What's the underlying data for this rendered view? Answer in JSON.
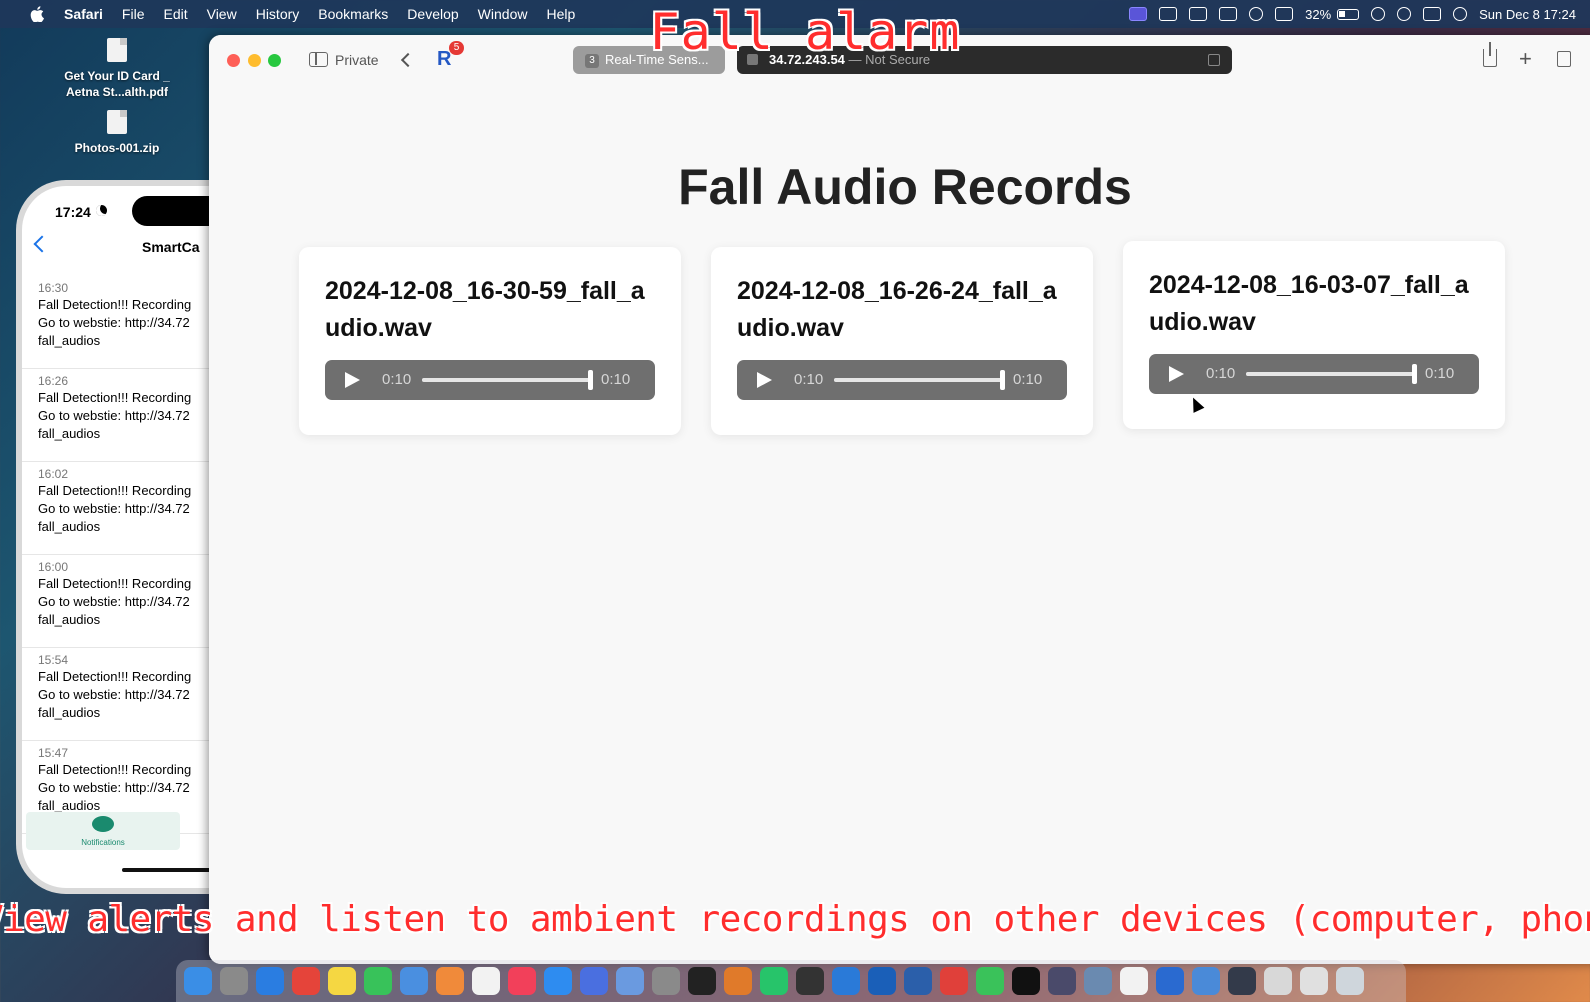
{
  "menubar": {
    "app": "Safari",
    "items": [
      "File",
      "Edit",
      "View",
      "History",
      "Bookmarks",
      "Develop",
      "Window",
      "Help"
    ],
    "battery": "32%",
    "datetime": "Sun Dec 8  17:24"
  },
  "overlay": {
    "title": "Fall alarm",
    "caption": "View alerts and listen to ambient recordings on other devices (computer, phone)"
  },
  "desktop": {
    "files": [
      {
        "name": "Get Your ID Card _ Aetna St...alth.pdf"
      },
      {
        "name": "Photos-001.zip"
      }
    ]
  },
  "phone": {
    "time": "17:24",
    "app_title": "SmartCa",
    "notifications": [
      {
        "time": "16:30",
        "line1": "Fall Detection!!! Recording",
        "line2": "Go to webstie: http://34.72",
        "line3": "fall_audios"
      },
      {
        "time": "16:26",
        "line1": "Fall Detection!!! Recording",
        "line2": "Go to webstie: http://34.72",
        "line3": "fall_audios"
      },
      {
        "time": "16:02",
        "line1": "Fall Detection!!! Recording",
        "line2": "Go to webstie: http://34.72",
        "line3": "fall_audios"
      },
      {
        "time": "16:00",
        "line1": "Fall Detection!!! Recording",
        "line2": "Go to webstie: http://34.72",
        "line3": "fall_audios"
      },
      {
        "time": "15:54",
        "line1": "Fall Detection!!! Recording",
        "line2": "Go to webstie: http://34.72",
        "line3": "fall_audios"
      },
      {
        "time": "15:47",
        "line1": "Fall Detection!!! Recording",
        "line2": "Go to webstie: http://34.72",
        "line3": "fall_audios"
      }
    ],
    "tab_label": "Notifications"
  },
  "safari": {
    "private_label": "Private",
    "extension_badge": "5",
    "tabs": [
      {
        "num": "3",
        "title": "Real-Time Sens..."
      },
      {
        "host": "34.72.243.54",
        "secure_label": " — Not Secure"
      }
    ]
  },
  "page": {
    "title": "Fall Audio Records",
    "records": [
      {
        "filename": "2024-12-08_16-30-59_fall_audio.wav",
        "current": "0:10",
        "duration": "0:10",
        "progress": 1.0
      },
      {
        "filename": "2024-12-08_16-26-24_fall_audio.wav",
        "current": "0:10",
        "duration": "0:10",
        "progress": 1.0
      },
      {
        "filename": "2024-12-08_16-03-07_fall_audio.wav",
        "current": "0:10",
        "duration": "0:10",
        "progress": 1.0
      }
    ]
  },
  "dock": {
    "icons": [
      "finder-icon",
      "launchpad-icon",
      "safari-icon",
      "chrome-icon",
      "notes-icon",
      "messages-icon",
      "mail-icon",
      "photos-icon",
      "reminders-icon",
      "music-icon",
      "app-store-icon",
      "qq-icon",
      "cat-app-icon",
      "system-settings-icon",
      "terminal-icon",
      "matlab-icon",
      "pycharm-icon",
      "unity-icon",
      "vscode-icon",
      "outlook-icon",
      "word-icon",
      "wps-icon",
      "wechat-icon",
      "x-icon",
      "quicktime-icon",
      "screen-icon",
      "chatgpt-icon",
      "r-icon",
      "rstudio-icon",
      "obs-icon",
      "pencil-icon",
      "keyboard-icon",
      "trash-icon"
    ],
    "colors": [
      "#3a8ee6",
      "#8a8a8a",
      "#2a7de1",
      "#e5443a",
      "#f5d742",
      "#38c25a",
      "#4a8fe0",
      "#f08a3a",
      "#f2f2f2",
      "#f2405a",
      "#2e8cf0",
      "#4a6fe0",
      "#6a9ae0",
      "#8a8a8a",
      "#222222",
      "#e07a2a",
      "#27c46a",
      "#333333",
      "#2a7ad8",
      "#1a5fb8",
      "#2b5faa",
      "#e0403a",
      "#3ac25a",
      "#111111",
      "#4a4a6a",
      "#6a8ab0",
      "#f2f2f2",
      "#2a6ad0",
      "#4a8ad8",
      "#333a4a",
      "#d8d8d8",
      "#e0e0e0",
      "#cfd6dc"
    ]
  }
}
